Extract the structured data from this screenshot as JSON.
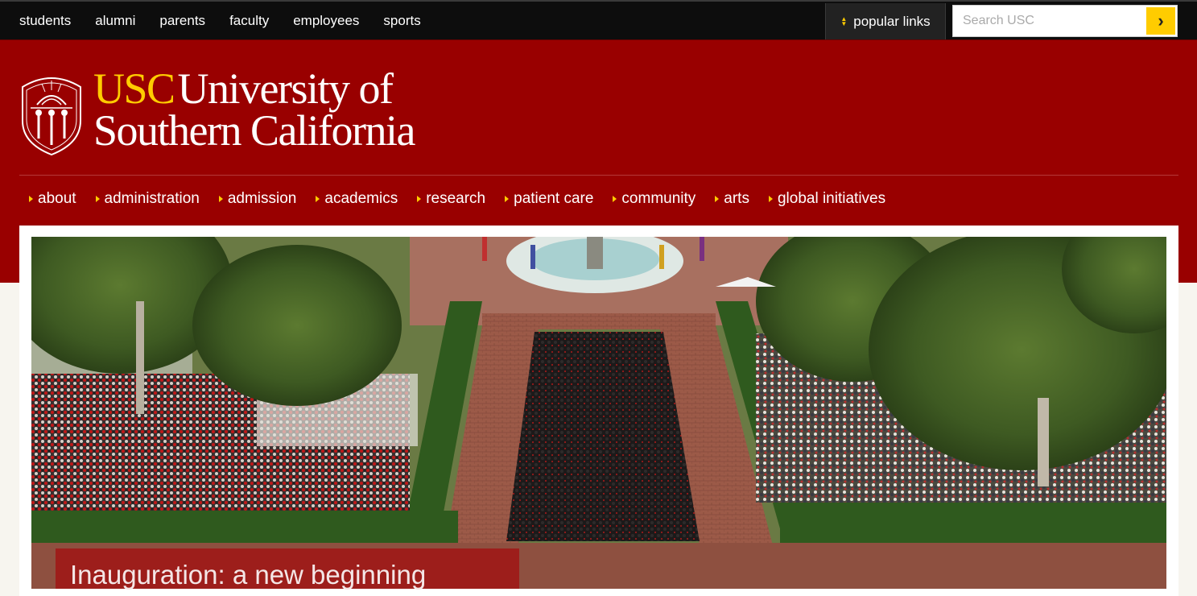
{
  "topbar": {
    "audience_links": [
      "students",
      "alumni",
      "parents",
      "faculty",
      "employees",
      "sports"
    ],
    "popular_links_label": "popular links",
    "search": {
      "placeholder": "Search USC",
      "value": "",
      "submit_icon": "chevron-right-icon"
    }
  },
  "header": {
    "logo": {
      "acronym": "USC",
      "name_line1": "University of",
      "name_line2": "Southern California"
    },
    "nav": [
      "about",
      "administration",
      "admission",
      "academics",
      "research",
      "patient care",
      "community",
      "arts",
      "global initiatives"
    ]
  },
  "hero": {
    "image_alt": "Aerial view of inauguration ceremony crowd around fountain and brick walkways",
    "caption": "Inauguration: a new beginning"
  },
  "colors": {
    "cardinal": "#990000",
    "gold": "#ffcc00",
    "topbar": "#0d0d0d"
  }
}
